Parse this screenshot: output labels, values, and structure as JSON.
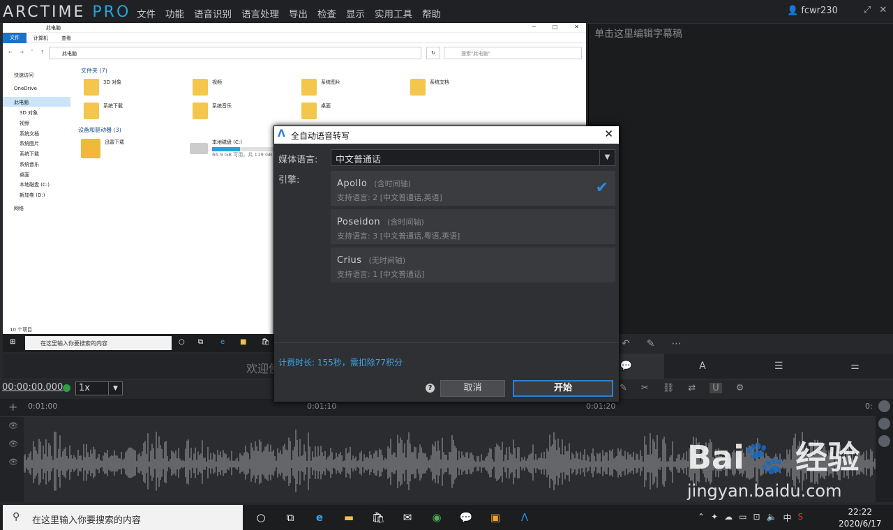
{
  "app": {
    "logo_main": "ARCTIME ",
    "logo_pro": "PRO",
    "user": "fcwr230",
    "menu": [
      "文件",
      "功能",
      "语音识别",
      "语言处理",
      "导出",
      "检查",
      "显示",
      "实用工具",
      "帮助"
    ]
  },
  "editor": {
    "placeholder": "单击这里编辑字幕稿",
    "welcome": "欢迎使"
  },
  "timeline": {
    "timecode": "00:00:00.000",
    "speed": "1x",
    "ticks": [
      "0:01:00",
      "0:01:10",
      "0:01:20",
      "0:"
    ]
  },
  "explorer": {
    "title": "此电脑",
    "ribbon": {
      "file": "文件",
      "computer": "计算机",
      "view": "查看"
    },
    "address": "此电脑",
    "search_placeholder": "搜索\"此电脑\"",
    "nav": [
      "快速访问",
      "OneDrive",
      "此电脑",
      "3D 对象",
      "视频",
      "系统文档",
      "系统图片",
      "系统下载",
      "系统音乐",
      "桌面",
      "本地磁盘 (C:)",
      "新加卷 (D:)",
      "网络"
    ],
    "folders_header": "文件夹 (7)",
    "folders": [
      "3D 对象",
      "视频",
      "系统图片",
      "系统文档",
      "系统下载",
      "系统音乐",
      "桌面"
    ],
    "devices_header": "设备和驱动器 (3)",
    "devices": [
      {
        "name": "迅雷下载"
      },
      {
        "name": "本地磁盘 (C:)",
        "info": "66.9 GB 可用，共 119 GB"
      }
    ],
    "status": "10 个项目",
    "taskbar_search": "在这里输入你要搜索的内容"
  },
  "dialog": {
    "title": "全自动语音转写",
    "lang_label": "媒体语言:",
    "lang_value": "中文普通话",
    "engine_label": "引擎:",
    "engines": [
      {
        "name": "Apollo",
        "tag": "(含时间轴)",
        "support": "支持语言: 2 [中文普通话,英语]"
      },
      {
        "name": "Poseidon",
        "tag": "(含时间轴)",
        "support": "支持语言: 3 [中文普通话,粤语,英语]"
      },
      {
        "name": "Crius",
        "tag": "(无时间轴)",
        "support": "支持语言: 1 [中文普通话]"
      }
    ],
    "cost": "计费时长: 155秒，需扣除77积分",
    "cancel": "取消",
    "start": "开始"
  },
  "taskbar": {
    "search": "在这里输入你要搜索的内容",
    "time": "22:22",
    "date": "2020/6/17",
    "ime": "中"
  },
  "watermark": {
    "brand": "Bai du 经验",
    "url": "jingyan.baidu.com"
  }
}
